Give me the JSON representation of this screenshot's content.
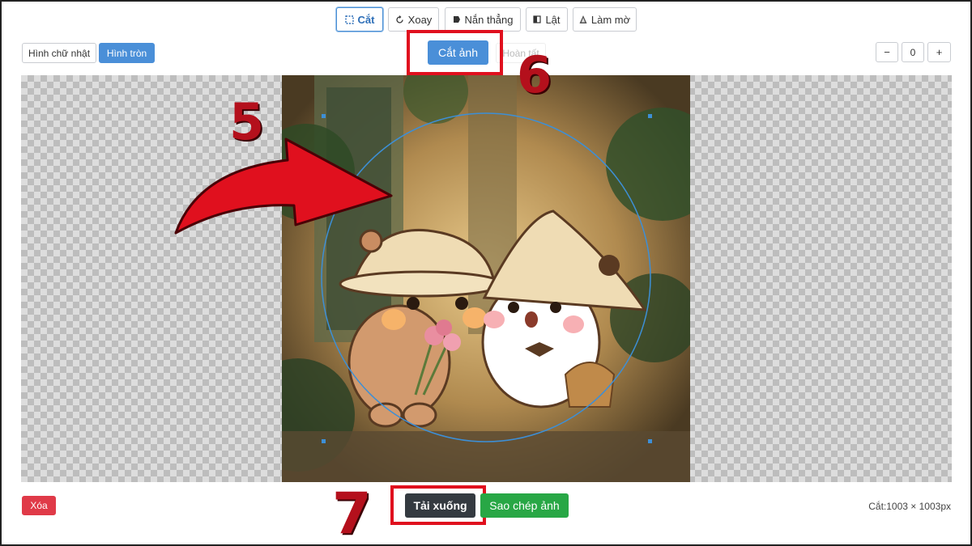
{
  "toolbar": {
    "tabs": [
      {
        "label": "Cắt",
        "icon": "crop-icon",
        "active": true
      },
      {
        "label": "Xoay",
        "icon": "rotate-icon",
        "active": false
      },
      {
        "label": "Nắn thẳng",
        "icon": "straighten-icon",
        "active": false
      },
      {
        "label": "Lật",
        "icon": "flip-icon",
        "active": false
      },
      {
        "label": "Làm mờ",
        "icon": "blur-icon",
        "active": false
      }
    ]
  },
  "shape": {
    "options": [
      {
        "label": "Hình chữ nhật",
        "active": false
      },
      {
        "label": "Hình tròn",
        "active": true
      }
    ]
  },
  "actions": {
    "crop_label": "Cắt ảnh",
    "done_label": "Hoàn tất"
  },
  "zoom": {
    "minus": "−",
    "value": "0",
    "plus": "+"
  },
  "footer": {
    "delete_label": "Xóa",
    "download_label": "Tải xuống",
    "copy_label": "Sao chép ảnh",
    "crop_size": "Cắt:1003 × 1003px"
  },
  "annotations": {
    "step5": "5",
    "step6": "6",
    "step7": "7"
  },
  "colors": {
    "primary": "#4a8fd8",
    "danger": "#e03a48",
    "dark": "#343a40",
    "success": "#28a745",
    "annotation": "#e0101e"
  }
}
